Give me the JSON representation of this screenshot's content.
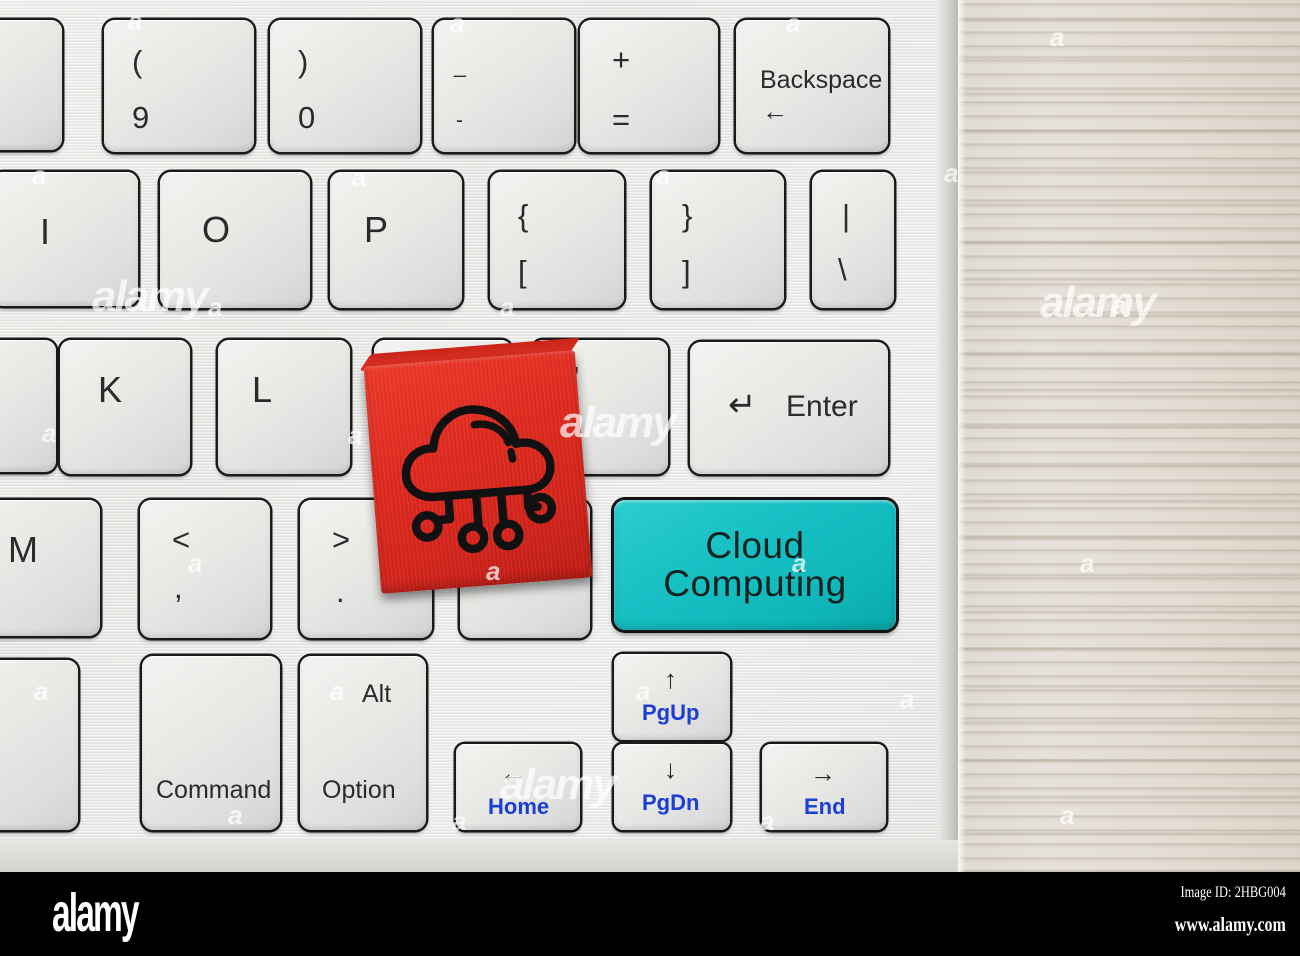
{
  "scene": {
    "description": "Red wooden cube with cloud computing icon resting on a white computer keyboard beside a turquoise Cloud Computing key",
    "colors": {
      "cube_red": "#e22a1f",
      "key_teal": "#16c0c3",
      "key_white": "#e8e8e5",
      "key_border": "#1a1a1a",
      "blue_legend": "#1b3fd6",
      "wood": "#e3ddd4",
      "footer_bg": "#000000"
    }
  },
  "keyboard": {
    "rows": [
      {
        "name": "number-row",
        "keys": [
          {
            "id": "key-partial-left-top",
            "top": "",
            "bottom": "",
            "center": ""
          },
          {
            "id": "key-9",
            "top": "(",
            "bottom": "9"
          },
          {
            "id": "key-0",
            "top": ")",
            "bottom": "0"
          },
          {
            "id": "key-minus",
            "top": "_",
            "bottom": "-"
          },
          {
            "id": "key-equal",
            "top": "+",
            "bottom": "="
          },
          {
            "id": "key-backspace",
            "word": "Backspace",
            "arrow": "←"
          }
        ]
      },
      {
        "name": "top-letter-row",
        "keys": [
          {
            "id": "key-i",
            "center": "I"
          },
          {
            "id": "key-o",
            "center": "O"
          },
          {
            "id": "key-p",
            "center": "P"
          },
          {
            "id": "key-bracket-left",
            "top": "{",
            "bottom": "["
          },
          {
            "id": "key-bracket-right",
            "top": "}",
            "bottom": "]"
          },
          {
            "id": "key-backslash",
            "top": "|",
            "bottom": "\\"
          }
        ]
      },
      {
        "name": "home-row",
        "keys": [
          {
            "id": "key-j-partial",
            "center": ""
          },
          {
            "id": "key-k",
            "center": "K"
          },
          {
            "id": "key-l",
            "center": "L"
          },
          {
            "id": "key-semicolon",
            "top": ":",
            "bottom": ";"
          },
          {
            "id": "key-quote",
            "top": "\"",
            "bottom": "'"
          },
          {
            "id": "key-enter",
            "word": "Enter",
            "arrow": "↵"
          }
        ]
      },
      {
        "name": "bottom-letter-row",
        "keys": [
          {
            "id": "key-m",
            "center": "M"
          },
          {
            "id": "key-comma",
            "top": "<",
            "bottom": ","
          },
          {
            "id": "key-period",
            "top": ">",
            "bottom": "."
          },
          {
            "id": "key-slash",
            "center": "/"
          },
          {
            "id": "key-cloud-computing",
            "line1": "Cloud",
            "line2": "Computing"
          }
        ]
      },
      {
        "name": "modifier-row",
        "keys": [
          {
            "id": "key-command",
            "word": "Command"
          },
          {
            "id": "key-option",
            "top": "Alt",
            "word": "Option"
          },
          {
            "id": "key-left-home",
            "arrow": "←",
            "legend": "Home"
          },
          {
            "id": "key-pgup",
            "arrow": "↑",
            "legend": "PgUp"
          },
          {
            "id": "key-pgdn",
            "arrow": "↓",
            "legend": "PgDn"
          },
          {
            "id": "key-right-end",
            "arrow": "→",
            "legend": "End"
          }
        ]
      }
    ]
  },
  "cube": {
    "icon_name": "cloud-computing-icon",
    "label": "Red wooden cube printed with a cloud connected to four network nodes"
  },
  "watermark": {
    "mark": "a",
    "word": "alamy"
  },
  "footer": {
    "logo": "alamy",
    "image_id": "Image ID: 2HBG004",
    "url": "www.alamy.com"
  }
}
